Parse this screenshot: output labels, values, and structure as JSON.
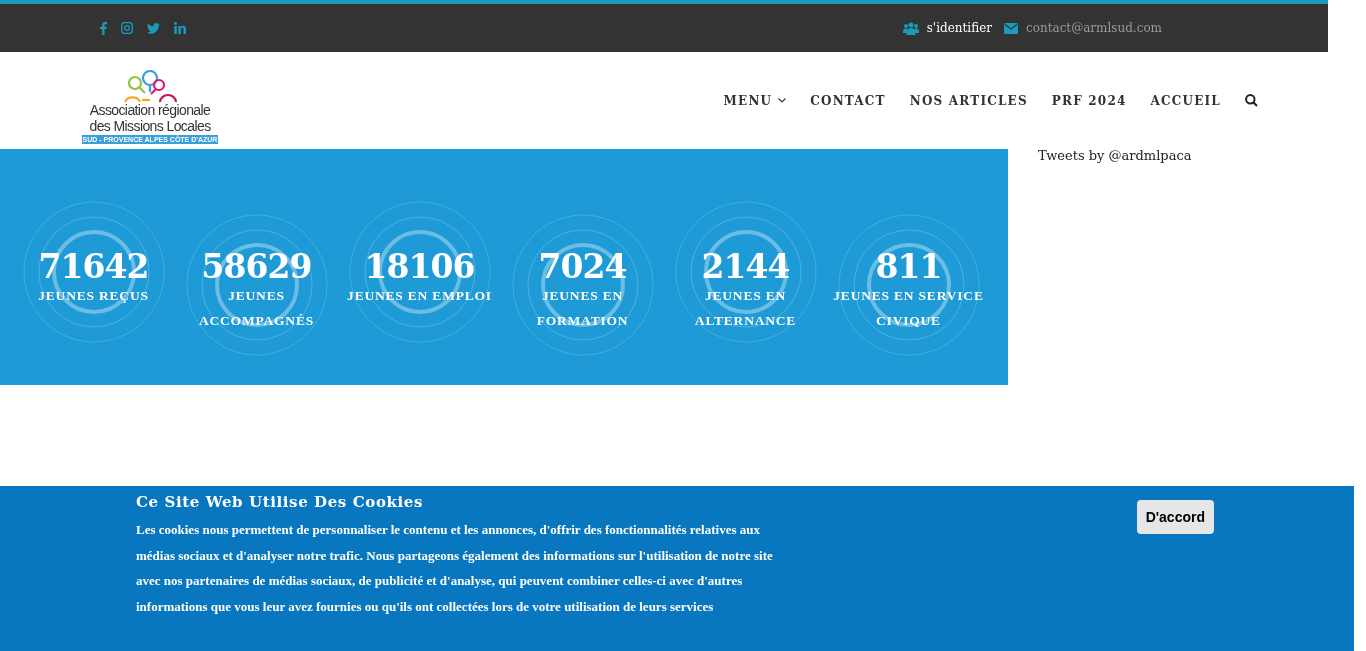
{
  "top_bar": {
    "social": [
      {
        "kind": "facebook"
      },
      {
        "kind": "instagram"
      },
      {
        "kind": "twitter"
      },
      {
        "kind": "linkedin"
      }
    ],
    "login": "s'identifier",
    "email": "contact@armlsud.com"
  },
  "logo": {
    "line_1": "Association régionale",
    "line_2": "des Missions Locales",
    "tagline": "SUD - PROVENCE ALPES CÔTE D'AZUR"
  },
  "nav": {
    "items": [
      {
        "label": "MENU",
        "dropdown": true
      },
      {
        "label": "CONTACT",
        "dropdown": false
      },
      {
        "label": "NOS ARTICLES",
        "dropdown": false
      },
      {
        "label": "PRF 2024",
        "dropdown": false
      },
      {
        "label": "ACCUEIL",
        "dropdown": false
      }
    ]
  },
  "stats": [
    {
      "value": "71642",
      "label": "JEUNES REÇUS"
    },
    {
      "value": "58629",
      "label": "JEUNES ACCOMPAGNÉS"
    },
    {
      "value": "18106",
      "label": "JEUNES EN EMPLOI"
    },
    {
      "value": "7024",
      "label": "JEUNES EN FORMATION"
    },
    {
      "value": "2144",
      "label": "JEUNES EN ALTERNANCE"
    },
    {
      "value": "811",
      "label": "JEUNES EN SERVICE CIVIQUE"
    }
  ],
  "sidebar": {
    "tweets_link": "Tweets by @ardmlpaca"
  },
  "cookie_banner": {
    "title": "Ce Site Web Utilise Des Cookies",
    "text": "Les cookies nous permettent de personnaliser le contenu et les annonces, d'offrir des fonctionnalités relatives aux médias sociaux et d'analyser notre trafic. Nous partageons également des informations sur l'utilisation de notre site avec nos partenaires de médias sociaux, de publicité et d'analyse, qui peuvent combiner celles-ci avec d'autres informations que vous leur avez fournies ou qu'ils ont collectées lors de votre utilisation de leurs services",
    "button": "D'accord"
  }
}
